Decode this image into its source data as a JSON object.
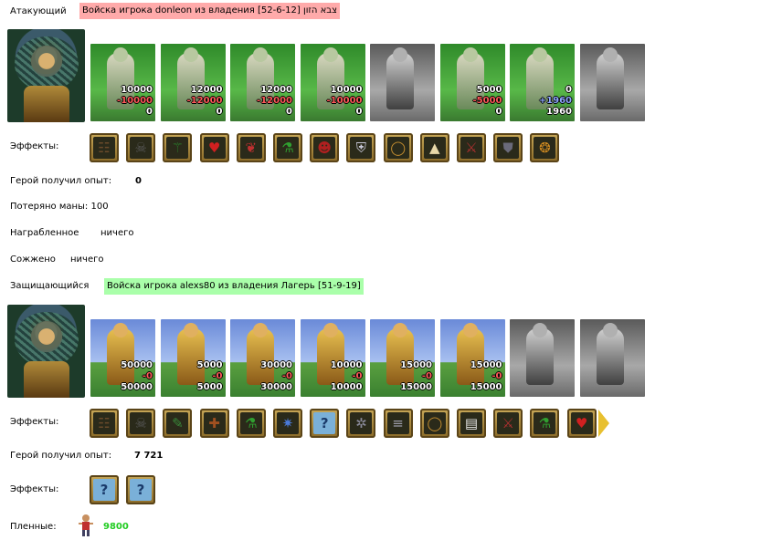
{
  "attacker": {
    "label": "Атакующий",
    "banner": "Войска игрока donleon из владения צבא הזון [52-6-12]",
    "banner_color": "#ffaaaa",
    "units": [
      {
        "name": "unit-1",
        "top": "10000",
        "mid": "-10000",
        "bot": "0",
        "scheme": "green"
      },
      {
        "name": "unit-2",
        "top": "12000",
        "mid": "-12000",
        "bot": "0",
        "scheme": "green"
      },
      {
        "name": "unit-3",
        "top": "12000",
        "mid": "-12000",
        "bot": "0",
        "scheme": "green"
      },
      {
        "name": "unit-4",
        "top": "10000",
        "mid": "-10000",
        "bot": "0",
        "scheme": "green"
      },
      {
        "name": "unit-5",
        "top": "",
        "mid": "",
        "bot": "",
        "scheme": "gray"
      },
      {
        "name": "unit-6",
        "top": "5000",
        "mid": "-5000",
        "bot": "0",
        "scheme": "green"
      },
      {
        "name": "unit-7",
        "top": "0",
        "mid": "+1960",
        "bot": "1960",
        "scheme": "green"
      },
      {
        "name": "unit-8",
        "top": "",
        "mid": "",
        "bot": "",
        "scheme": "gray"
      }
    ],
    "effects_label": "Эффекты:",
    "effects": [
      "totem-icon",
      "skull-icon",
      "staff-icon",
      "heart-icon",
      "heart-ring-icon",
      "potion-icon",
      "mask-icon",
      "chest-armor-icon",
      "ring-icon",
      "tent-icon",
      "sword-icon",
      "shield-icon",
      "coins-icon"
    ],
    "exp_label": "Герой получил опыт:",
    "exp_value": "0",
    "mana_text": "Потеряно маны: 100",
    "loot_label": "Награбленное",
    "loot_value": "ничего",
    "burned_label": "Сожжено",
    "burned_value": "ничего"
  },
  "defender": {
    "label": "Защищающийся",
    "banner": "Войска игрока alexs80 из владения Лагерь [51-9-19]",
    "banner_color": "#aaffaa",
    "units": [
      {
        "name": "unit-1",
        "top": "50000",
        "mid": "-0",
        "bot": "50000",
        "scheme": "sky"
      },
      {
        "name": "unit-2",
        "top": "5000",
        "mid": "-0",
        "bot": "5000",
        "scheme": "sky"
      },
      {
        "name": "unit-3",
        "top": "30000",
        "mid": "-0",
        "bot": "30000",
        "scheme": "sky"
      },
      {
        "name": "unit-4",
        "top": "10000",
        "mid": "-0",
        "bot": "10000",
        "scheme": "sky"
      },
      {
        "name": "unit-5",
        "top": "15000",
        "mid": "-0",
        "bot": "15000",
        "scheme": "sky"
      },
      {
        "name": "unit-6",
        "top": "15000",
        "mid": "-0",
        "bot": "15000",
        "scheme": "sky"
      },
      {
        "name": "unit-7",
        "top": "",
        "mid": "",
        "bot": "",
        "scheme": "gray"
      },
      {
        "name": "unit-8",
        "top": "",
        "mid": "",
        "bot": "",
        "scheme": "gray"
      }
    ],
    "effects_label": "Эффекты:",
    "effects": [
      "totem-icon",
      "skull-icon",
      "scroll-icon",
      "sword-book-icon",
      "potion-icon",
      "spark-icon",
      "question-icon",
      "web-icon",
      "barrel-icon",
      "ring-icon",
      "paper-icon",
      "sword-icon",
      "potion-icon",
      "heart-icon"
    ],
    "exp_label": "Герой получил опыт:",
    "exp_value": "7 721",
    "effects2_label": "Эффекты:",
    "effects2": [
      "question-icon",
      "question-icon"
    ],
    "prisoners_label": "Пленные:",
    "prisoners_value": "9800",
    "prisoners_color": "#22cc22"
  }
}
